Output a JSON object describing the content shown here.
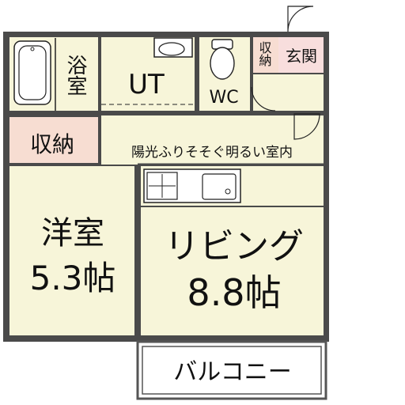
{
  "colors": {
    "floor": "#f7f5d9",
    "storage": "#f7ddd2",
    "entrance": "#f8dedd",
    "wall": "#4a4a4a",
    "line": "#222222"
  },
  "rooms": {
    "bath": {
      "label": "浴室"
    },
    "ut": {
      "label": "UT"
    },
    "wc": {
      "label": "WC"
    },
    "storage_small": {
      "label": "収納"
    },
    "entrance": {
      "label": "玄関"
    },
    "storage": {
      "label": "収納"
    },
    "western": {
      "name": "洋室",
      "size": "5.3帖"
    },
    "living": {
      "name": "リビング",
      "size": "8.8帖"
    },
    "balcony": {
      "label": "バルコニー"
    }
  },
  "caption": "陽光ふりそそぐ明るい室内"
}
